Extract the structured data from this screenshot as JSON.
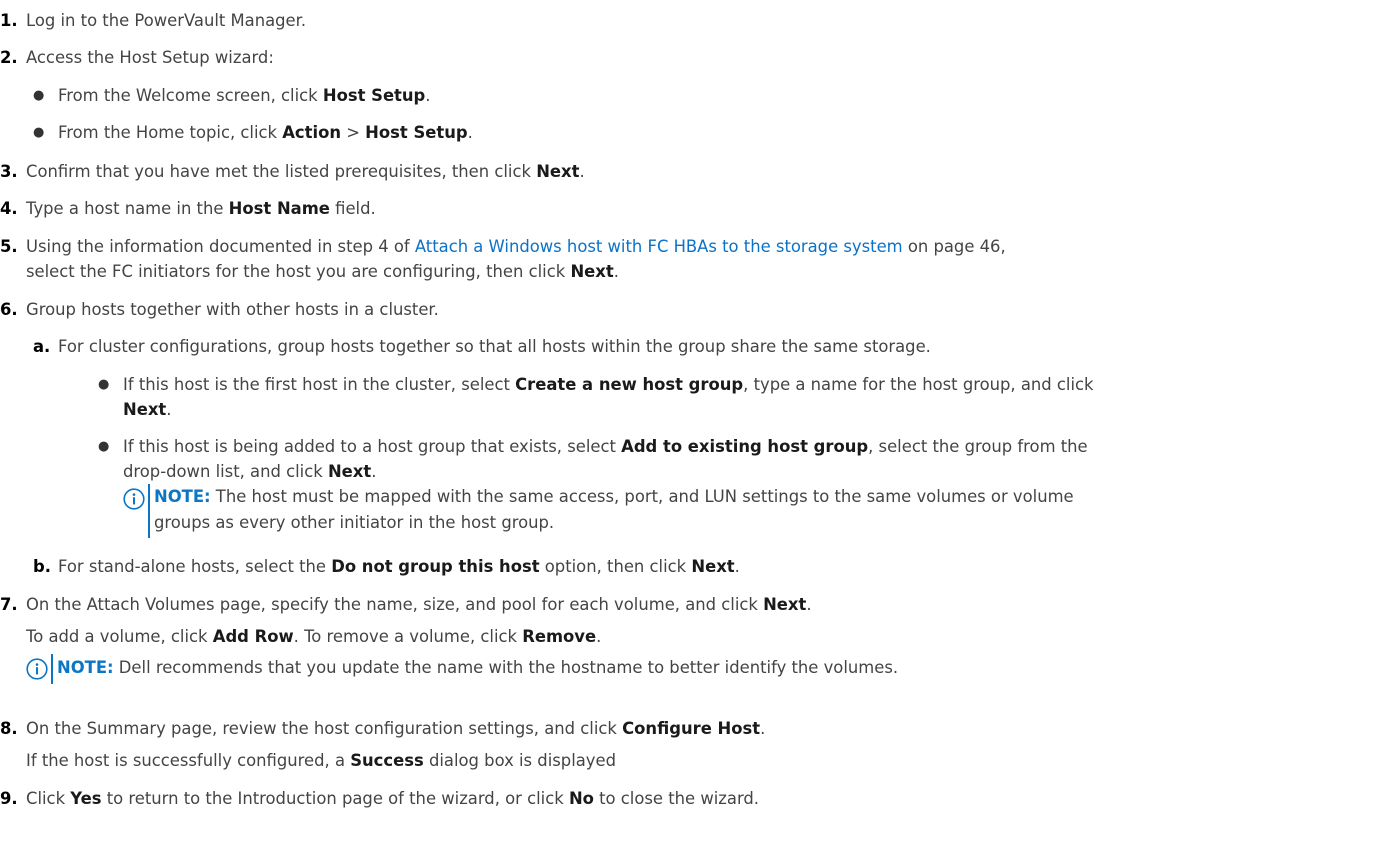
{
  "steps": {
    "s1": {
      "num": "1.",
      "text": "Log in to the PowerVault Manager."
    },
    "s2": {
      "num": "2.",
      "text": "Access the Host Setup wizard:",
      "b1": {
        "pre": "From the Welcome screen, click ",
        "bold": "Host Setup",
        "post": "."
      },
      "b2": {
        "pre": "From the Home topic, click ",
        "bold1": "Action",
        "mid": " > ",
        "bold2": "Host Setup",
        "post": "."
      }
    },
    "s3": {
      "num": "3.",
      "pre": "Confirm that you have met the listed prerequisites, then click ",
      "bold": "Next",
      "post": "."
    },
    "s4": {
      "num": "4.",
      "pre": "Type a host name in the ",
      "bold": "Host Name",
      "post": " field."
    },
    "s5": {
      "num": "5.",
      "pre": "Using the information documented in step 4 of ",
      "link": "Attach a Windows host with FC HBAs to the storage system",
      "post": " on page 46,",
      "line2_pre": "select the FC initiators for the host you are configuring, then click ",
      "line2_bold": "Next",
      "line2_post": "."
    },
    "s6": {
      "num": "6.",
      "text": "Group hosts together with other hosts in a cluster.",
      "a": {
        "label": "a.",
        "text": "For cluster configurations, group hosts together so that all hosts within the group share the same storage.",
        "b1": {
          "pre": "If this host is the first host in the cluster, select ",
          "bold": "Create a new host group",
          "post": ", type a name for the host group, and click",
          "line2_bold": "Next",
          "line2_post": "."
        },
        "b2": {
          "pre": "If this host is being added to a host group that exists, select ",
          "bold": "Add to existing host group",
          "post": ", select the group from the",
          "line2_pre": "drop-down list, and click ",
          "line2_bold": "Next",
          "line2_post": "."
        },
        "note": {
          "label": "NOTE:",
          "text": " The host must be mapped with the same access, port, and LUN settings to the same volumes or volume",
          "line2": "groups as every other initiator in the host group."
        }
      },
      "b": {
        "label": "b.",
        "pre": "For stand-alone hosts, select the ",
        "bold1": "Do not group this host",
        "mid": " option, then click ",
        "bold2": "Next",
        "post": "."
      }
    },
    "s7": {
      "num": "7.",
      "pre": "On the Attach Volumes page, specify the name, size, and pool for each volume, and click ",
      "bold": "Next",
      "post": ".",
      "sub_pre": "To add a volume, click ",
      "sub_bold1": "Add Row",
      "sub_mid": ". To remove a volume, click ",
      "sub_bold2": "Remove",
      "sub_post": ".",
      "note": {
        "label": "NOTE:",
        "text": " Dell recommends that you update the name with the hostname to better identify the volumes."
      }
    },
    "s8": {
      "num": "8.",
      "pre": "On the Summary page, review the host configuration settings, and click ",
      "bold": "Configure Host",
      "post": ".",
      "sub_pre": "If the host is successfully configured, a ",
      "sub_bold": "Success",
      "sub_post": " dialog box is displayed"
    },
    "s9": {
      "num": "9.",
      "pre": "Click ",
      "bold1": "Yes",
      "mid": " to return to the Introduction page of the wizard, or click ",
      "bold2": "No",
      "post": " to close the wizard."
    }
  },
  "colors": {
    "note_accent": "#0b76c6",
    "link": "#0b72c8"
  }
}
